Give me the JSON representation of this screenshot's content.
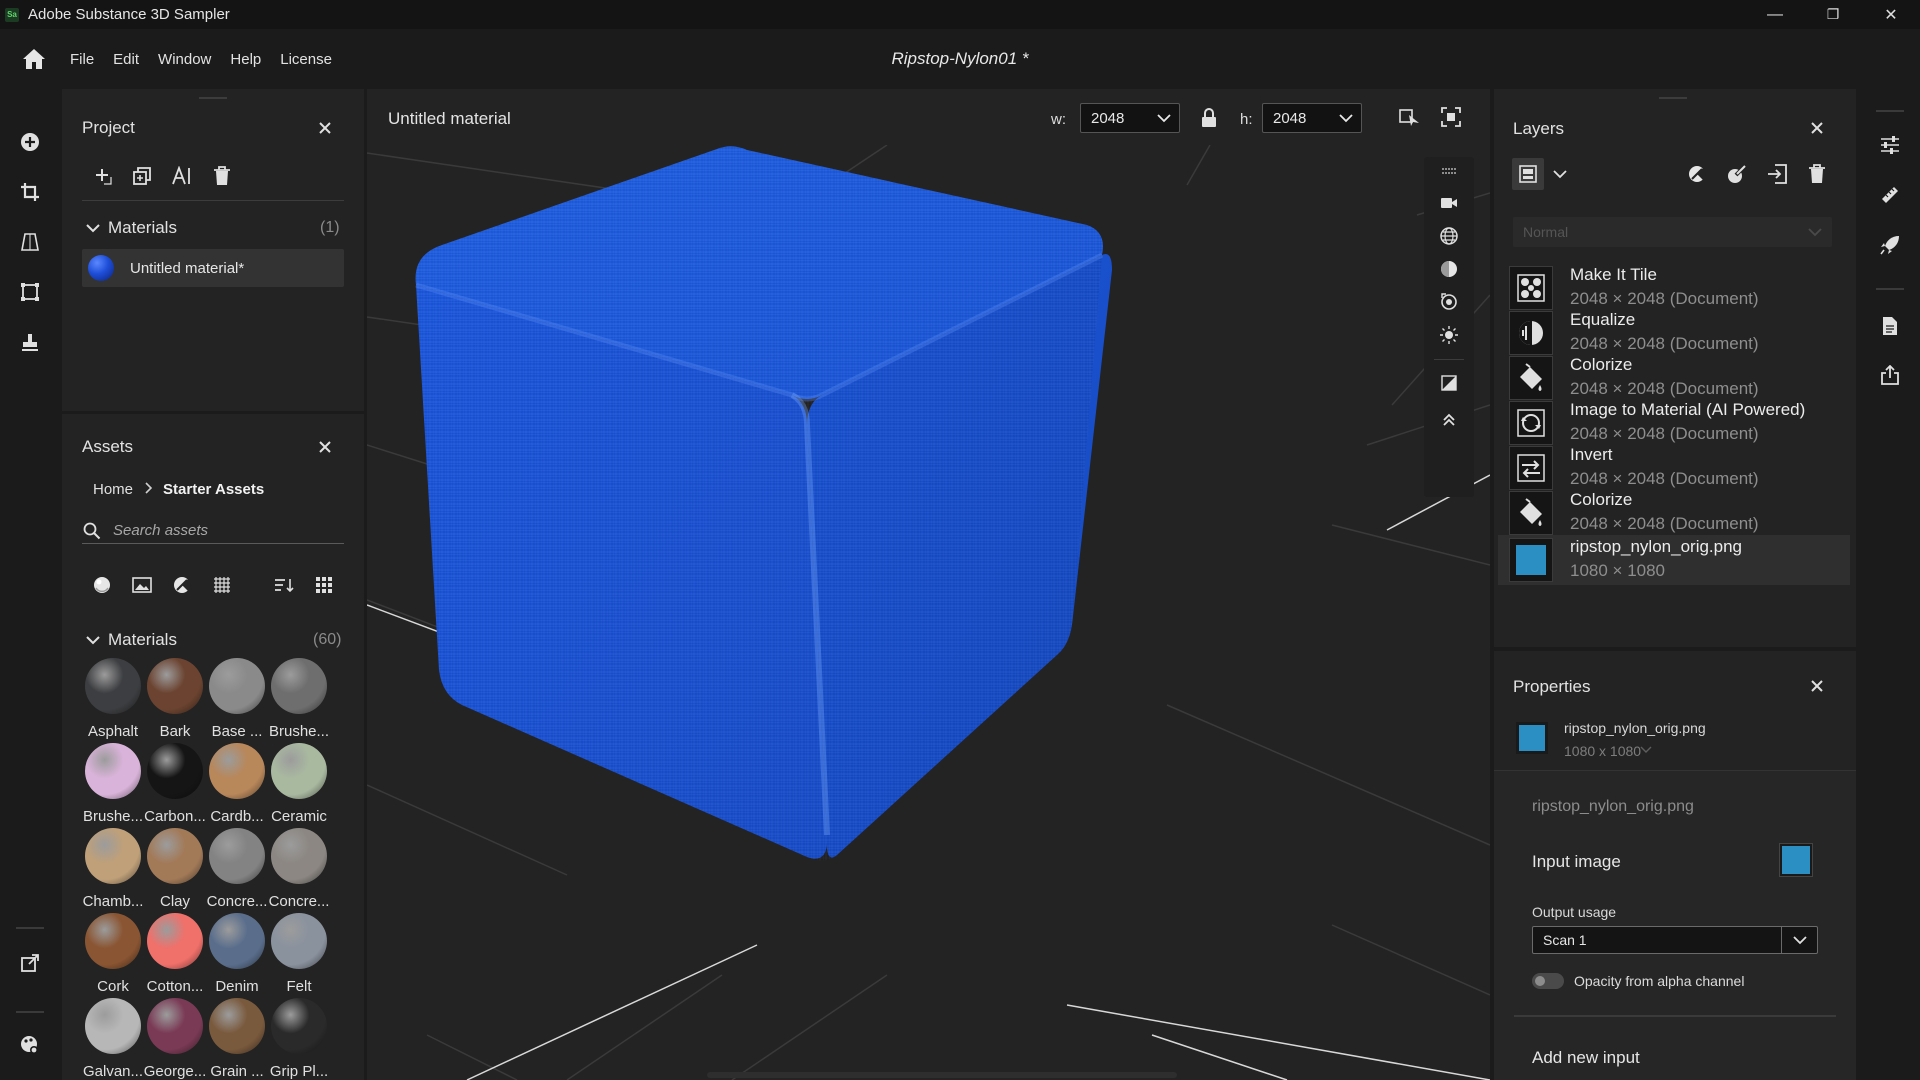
{
  "app": {
    "title": "Adobe Substance 3D Sampler",
    "icon_text": "Sa",
    "document_title": "Ripstop-Nylon01 *"
  },
  "window_buttons": {
    "minimize": "—",
    "restore": "❐",
    "close": "✕"
  },
  "menu": [
    "File",
    "Edit",
    "Window",
    "Help",
    "License"
  ],
  "project": {
    "title": "Project",
    "section_label": "Materials",
    "section_count": "(1)",
    "items": [
      {
        "name": "Untitled material*"
      }
    ]
  },
  "assets": {
    "title": "Assets",
    "breadcrumb": {
      "home": "Home",
      "current": "Starter Assets"
    },
    "search_placeholder": "Search assets",
    "section_label": "Materials",
    "section_count": "(60)",
    "items": [
      {
        "label": "Asphalt",
        "color": "#3d3e41"
      },
      {
        "label": "Bark",
        "color": "#6b4330"
      },
      {
        "label": "Base ...",
        "color": "#8a8a8a"
      },
      {
        "label": "Brushe...",
        "color": "#6e6e6e"
      },
      {
        "label": "Brushe...",
        "color": "#d9b3d9"
      },
      {
        "label": "Carbon...",
        "color": "#151515"
      },
      {
        "label": "Cardb...",
        "color": "#b8875a"
      },
      {
        "label": "Ceramic",
        "color": "#a9b9a0"
      },
      {
        "label": "Chamb...",
        "color": "#bfa079"
      },
      {
        "label": "Clay",
        "color": "#a27a58"
      },
      {
        "label": "Concre...",
        "color": "#838383"
      },
      {
        "label": "Concre...",
        "color": "#8c8782"
      },
      {
        "label": "Cork",
        "color": "#8a5532"
      },
      {
        "label": "Cotton...",
        "color": "#f0706a"
      },
      {
        "label": "Denim",
        "color": "#5a6e8c"
      },
      {
        "label": "Felt",
        "color": "#8a929e"
      },
      {
        "label": "Galvan...",
        "color": "#b7b7b7"
      },
      {
        "label": "George...",
        "color": "#7a3a55"
      },
      {
        "label": "Grain ...",
        "color": "#7a5a3d"
      },
      {
        "label": "Grip Pl...",
        "color": "#2a2a2a"
      }
    ]
  },
  "viewport": {
    "title": "Untitled material",
    "width_label": "w:",
    "width_value": "2048",
    "height_label": "h:",
    "height_value": "2048",
    "cube_color": "#1f5ad6"
  },
  "layers": {
    "title": "Layers",
    "blend_mode": "Normal",
    "items": [
      {
        "name": "Make It Tile",
        "sub": "2048 × 2048 (Document)",
        "icon": "tile-icon"
      },
      {
        "name": "Equalize",
        "sub": "2048 × 2048 (Document)",
        "icon": "equalize-icon"
      },
      {
        "name": "Colorize",
        "sub": "2048 × 2048 (Document)",
        "icon": "paint-bucket-icon"
      },
      {
        "name": "Image to Material (AI Powered)",
        "sub": "2048 × 2048 (Document)",
        "icon": "ai-material-icon"
      },
      {
        "name": "Invert",
        "sub": "2048 × 2048 (Document)",
        "icon": "invert-icon"
      },
      {
        "name": "Colorize",
        "sub": "2048 × 2048 (Document)",
        "icon": "paint-bucket-icon"
      },
      {
        "name": "ripstop_nylon_orig.png",
        "sub": "1080 × 1080",
        "icon": "image-thumb",
        "selected": true
      }
    ]
  },
  "properties": {
    "title": "Properties",
    "file_name": "ripstop_nylon_orig.png",
    "file_size": "1080 x 1080",
    "section_name": "ripstop_nylon_orig.png",
    "input_image_label": "Input image",
    "output_usage_label": "Output usage",
    "output_usage_value": "Scan 1",
    "opacity_label": "Opacity from alpha channel",
    "add_input_label": "Add new input",
    "thumb_color": "#2b8fc4"
  }
}
